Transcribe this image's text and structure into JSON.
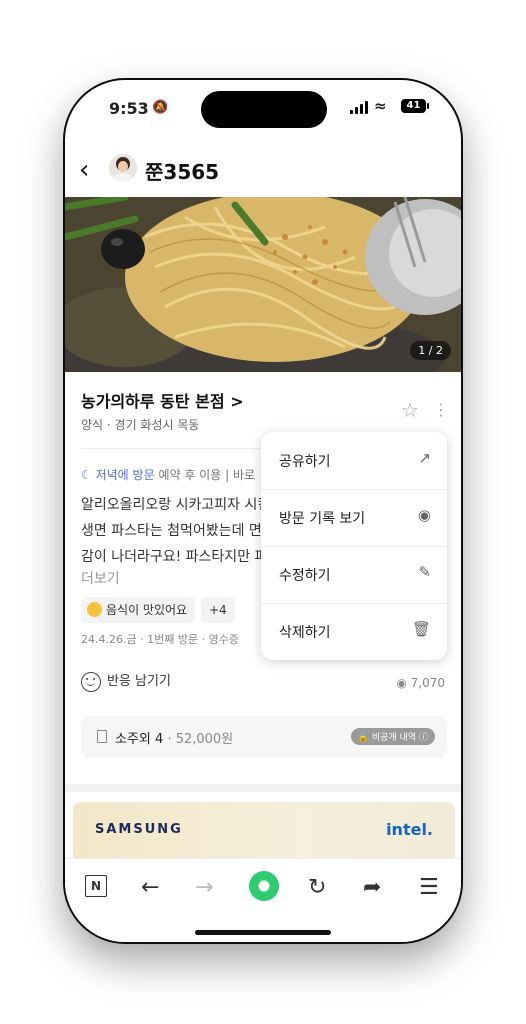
{
  "status": {
    "time": "9:53",
    "battery": "41"
  },
  "header": {
    "back_icon": "chevron-left-icon",
    "username": "쭌3565"
  },
  "photo": {
    "counter": "1 / 2"
  },
  "place": {
    "name": "농가의하루 동탄 본점 >",
    "category": "양식 · 경기 화성시 목동"
  },
  "review": {
    "visit_time": "저녁에 방문",
    "visit_meta": "예약 후 이용 | 바로",
    "lines": [
      "알리오올리오랑 시카고피자 시킨",
      "생면 파스타는 첨먹어봤는데 면",
      "감이 나더라구요! 파스타지만 피"
    ],
    "more": "더보기",
    "tag": "음식이 맛있어요",
    "tag_more": "+4",
    "meta": "24.4.26.금 · 1번째 방문 · 영수증"
  },
  "reaction": {
    "label": "반응 남기기",
    "views": "7,070"
  },
  "receipt": {
    "item": "소주외 4",
    "price": "· 52,000원",
    "private": "비공개 내역"
  },
  "ad": {
    "brand1": "SAMSUNG",
    "brand2": "intel."
  },
  "menu": {
    "items": [
      {
        "label": "공유하기",
        "icon": "share-icon"
      },
      {
        "label": "방문 기록 보기",
        "icon": "location-pin-icon"
      },
      {
        "label": "수정하기",
        "icon": "pencil-icon"
      },
      {
        "label": "삭제하기",
        "icon": "trash-icon"
      }
    ]
  },
  "toolbar": {
    "n_label": "N"
  },
  "colors": {
    "accent_green": "#2ecc71",
    "visit_blue": "#4b6fd6"
  }
}
